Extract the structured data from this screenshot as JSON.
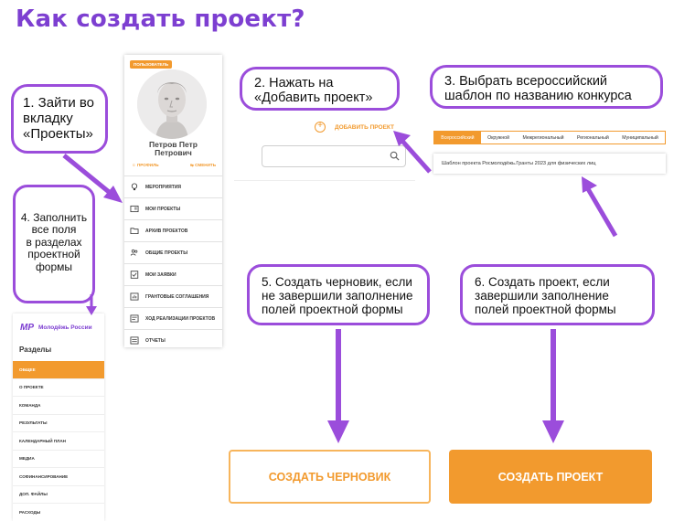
{
  "title": "Как создать проект?",
  "callouts": {
    "step1": [
      "1. Зайти во",
      "вкладку",
      "«Проекты»"
    ],
    "step2": [
      "2. Нажать на",
      "«Добавить проект»"
    ],
    "step3": [
      "3. Выбрать всероссийский",
      "шаблон по названию конкурса"
    ],
    "step4": [
      "4. Заполнить",
      "все поля",
      "в разделах",
      "проектной",
      "формы"
    ],
    "step5": [
      "5. Создать черновик, если",
      "не завершили заполнение",
      "полей проектной формы"
    ],
    "step6": [
      "6. Создать проект, если",
      "завершили заполнение",
      "полей проектной формы"
    ]
  },
  "profile": {
    "role_badge": "ПОЛЬЗОВАТЕЛЬ",
    "name_line1": "Петров Петр",
    "name_line2": "Петрович",
    "link_profile": "ПРОФИЛЬ",
    "link_change": "СМЕНИТЬ",
    "menu": [
      {
        "label": "МЕРОПРИЯТИЯ",
        "icon": "lightbulb-icon"
      },
      {
        "label": "МОИ ПРОЕКТЫ",
        "icon": "id-card-icon"
      },
      {
        "label": "АРХИВ ПРОЕКТОВ",
        "icon": "folder-icon"
      },
      {
        "label": "ОБЩИЕ ПРОЕКТЫ",
        "icon": "users-icon"
      },
      {
        "label": "МОИ ЗАЯВКИ",
        "icon": "checkbox-icon"
      },
      {
        "label": "ГРАНТОВЫЕ СОГЛАШЕНИЯ",
        "icon": "chart-icon"
      },
      {
        "label": "ХОД РЕАЛИЗАЦИИ ПРОЕКТОВ",
        "icon": "progress-icon"
      },
      {
        "label": "ОТЧЕТЫ",
        "icon": "report-icon"
      }
    ]
  },
  "add_project": {
    "button_label": "ДОБАВИТЬ ПРОЕКТ",
    "search_placeholder": ""
  },
  "templates": {
    "tabs": [
      "Всероссийский",
      "Окружной",
      "Межрегиональный",
      "Региональный",
      "Муниципальный"
    ],
    "active_tab": "Всероссийский",
    "row": "Шаблон проекта Росмолодёжь.Гранты 2023 для физических лиц"
  },
  "sections": {
    "logo_mark": "МР",
    "logo_text": "Молодёжь России",
    "heading": "Разделы",
    "items": [
      "ОБЩЕЕ",
      "О ПРОЕКТЕ",
      "КОМАНДА",
      "РЕЗУЛЬТАТЫ",
      "КАЛЕНДАРНЫЙ ПЛАН",
      "МЕДИА",
      "СОФИНАНСИРОВАНИЕ",
      "ДОП. ФАЙЛЫ",
      "РАСХОДЫ"
    ],
    "active_item": "ОБЩЕЕ"
  },
  "buttons": {
    "create_draft": "СОЗДАТЬ ЧЕРНОВИК",
    "create_project": "СОЗДАТЬ ПРОЕКТ"
  },
  "colors": {
    "accent_purple": "#9b4ddb",
    "title_purple": "#7d3fd1",
    "brand_orange": "#f29a2e"
  }
}
